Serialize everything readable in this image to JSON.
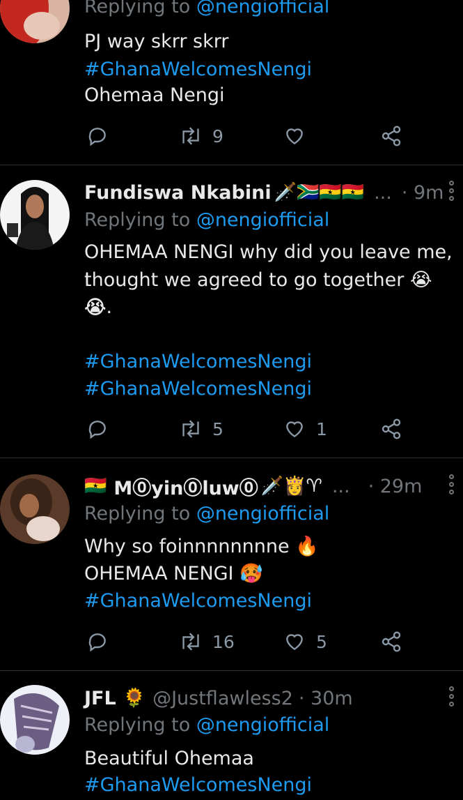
{
  "tweets": [
    {
      "reply_prefix": "Replying to ",
      "reply_mention": "@nengiofficial",
      "line1": "PJ way skrr skrr ",
      "line1_tag": "#GhanaWelcomesNengi",
      "line3": "Ohemaa Nengi",
      "retweets": "9",
      "likes": ""
    },
    {
      "name": "Fundiswa Nkabini",
      "emojis": "🗡️🇿🇦🇬🇭🇬🇭",
      "ellipsis": "...",
      "time": "· 9m",
      "reply_prefix": "Replying to ",
      "reply_mention": "@nengiofficial",
      "line1": "OHEMAA NENGI why did you leave me, I",
      "line2": "thought we agreed to go together 😭😭",
      "line3": "😭.",
      "tag1": "#GhanaWelcomesNengi",
      "tag2": "#GhanaWelcomesNengi",
      "retweets": "5",
      "likes": "1"
    },
    {
      "flag": "🇬🇭",
      "name": "M⓪yin⓪luw⓪",
      "emojis": "🗡️👸♈",
      "ellipsis": "...",
      "time": "· 29m",
      "reply_prefix": "Replying to ",
      "reply_mention": "@nengiofficial",
      "line1": "Why so foinnnnnnnne 🔥",
      "line2": "OHEMAA NENGI 🥵",
      "tag1": "#GhanaWelcomesNengi",
      "retweets": "16",
      "likes": "5"
    },
    {
      "name": "JFL",
      "emojis": "🌻",
      "handle": "@Justflawless2",
      "time": "· 30m",
      "reply_prefix": "Replying to ",
      "reply_mention": "@nengiofficial",
      "line1": "Beautiful Ohemaa",
      "tag1": "#GhanaWelcomesNengi"
    }
  ],
  "colors": {
    "accent": "#1d9bf0",
    "muted": "#71767b",
    "background": "#000000"
  }
}
